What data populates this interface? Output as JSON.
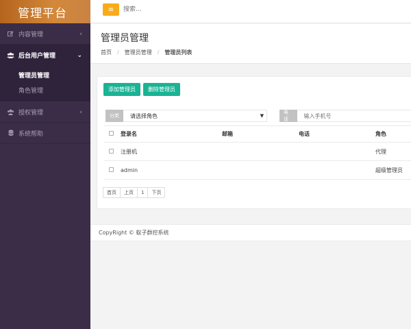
{
  "sidebar": {
    "brand": "管理平台",
    "items": [
      {
        "label": "内容管理",
        "icon": "edit-icon",
        "arrow": "‹"
      },
      {
        "label": "后台用户管理",
        "icon": "users-icon",
        "arrow": "⌄",
        "children": [
          "管理员管理",
          "角色管理"
        ]
      },
      {
        "label": "授权管理",
        "icon": "key-group-icon",
        "arrow": "‹"
      },
      {
        "label": "系统帮助",
        "icon": "database-icon",
        "arrow": ""
      }
    ]
  },
  "topbar": {
    "toggle_icon": "hamburger-icon",
    "search_placeholder": "搜索..."
  },
  "heading": {
    "title": "管理员管理",
    "breadcrumb": [
      "首页",
      "管理员管理",
      "管理员列表"
    ]
  },
  "toolbar": {
    "add_label": "添加管理员",
    "delete_label": "删除管理员"
  },
  "filters": {
    "category_label": "分类",
    "role_select_value": "请选择角色",
    "phone_label": "电话",
    "phone_placeholder": "输入手机号"
  },
  "table": {
    "columns": [
      "登录名",
      "邮箱",
      "电话",
      "角色"
    ],
    "rows": [
      {
        "login": "注册机",
        "email": "",
        "phone": "",
        "role": "代理"
      },
      {
        "login": "admin",
        "email": "",
        "phone": "",
        "role": "超级管理员"
      }
    ]
  },
  "pagination": [
    "首页",
    "上页",
    "1",
    "下页"
  ],
  "footer": {
    "copyright": "CopyRight © 蚁子群控系统"
  },
  "colors": {
    "sidebar_bg": "#3b2d48",
    "brand_gradient": "#d3883a",
    "accent_teal": "#1ab394",
    "toggle_yellow": "#f8ac1a"
  }
}
